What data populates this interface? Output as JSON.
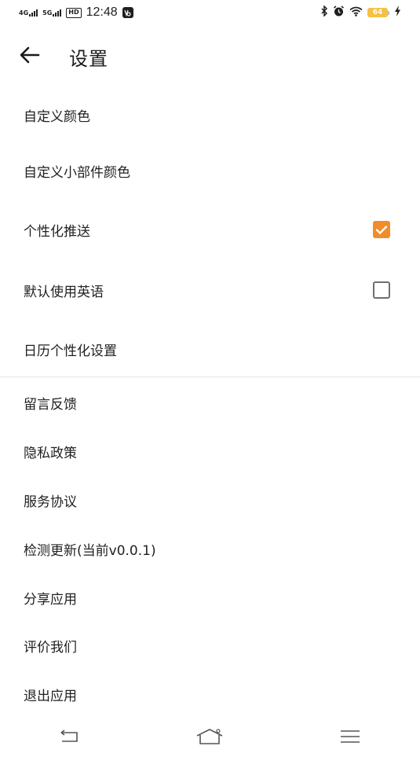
{
  "status_bar": {
    "net1": "4G",
    "net2": "5G",
    "hd": "HD",
    "time": "12:48",
    "vo_icon": "volte-icon",
    "battery": "64",
    "icons": [
      "bluetooth-icon",
      "alarm-icon",
      "wifi-icon",
      "battery-icon",
      "charging-icon"
    ]
  },
  "header": {
    "title": "设置",
    "back_icon": "arrow-left-icon"
  },
  "settings": {
    "custom_color": "自定义颜色",
    "widget_color": "自定义小部件颜色",
    "personalized_push": "个性化推送",
    "personalized_push_checked": true,
    "default_english": "默认使用英语",
    "default_english_checked": false,
    "calendar_personalization": "日历个性化设置",
    "feedback": "留言反馈",
    "privacy_policy": "隐私政策",
    "service_agreement": "服务协议",
    "check_update": "检测更新(当前v0.0.1)",
    "share_app": "分享应用",
    "rate_us": "评价我们",
    "exit_app": "退出应用"
  },
  "colors": {
    "accent": "#f08c2a",
    "text": "#222222",
    "divider": "#e3e3e3"
  },
  "nav_bar": {
    "icons": [
      "back-nav-icon",
      "home-nav-icon",
      "menu-nav-icon"
    ]
  }
}
